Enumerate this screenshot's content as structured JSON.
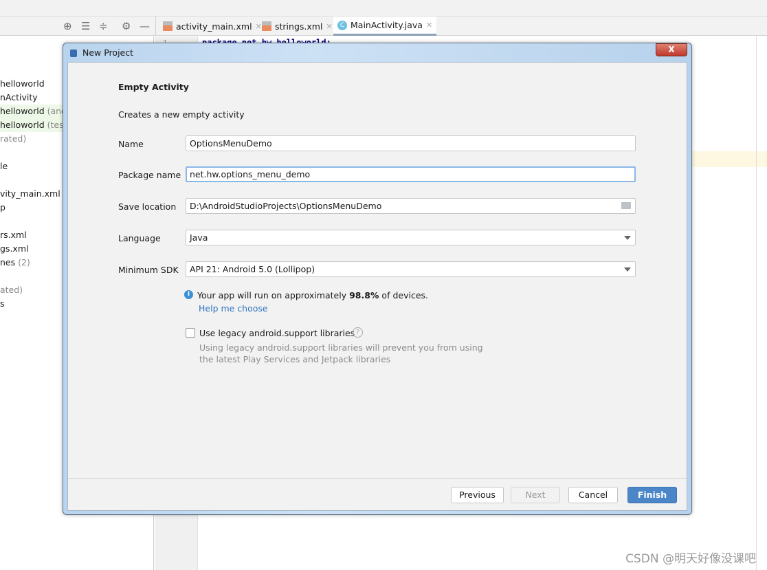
{
  "toolbar": {
    "icons": [
      "locate-icon",
      "expand-all-icon",
      "collapse-all-icon",
      "gear-icon",
      "minimize-icon"
    ]
  },
  "tabs": [
    {
      "label": "activity_main.xml",
      "icon": "xml-file-icon"
    },
    {
      "label": "strings.xml",
      "icon": "xml-file-icon"
    },
    {
      "label": "MainActivity.java",
      "icon": "java-class-icon",
      "active": true
    }
  ],
  "project_tree": [
    {
      "text": "helloworld",
      "dim": ""
    },
    {
      "text": "nActivity",
      "dim": ""
    },
    {
      "text": "helloworld",
      "dim": " (andr"
    },
    {
      "text": "helloworld",
      "dim": " (test)"
    },
    {
      "text": "",
      "dim": "rated)"
    },
    {
      "text": "le",
      "dim": ""
    },
    {
      "text": "vity_main.xml",
      "dim": ""
    },
    {
      "text": "p",
      "dim": ""
    },
    {
      "text": "rs.xml",
      "dim": ""
    },
    {
      "text": "gs.xml",
      "dim": ""
    },
    {
      "text": "nes",
      "dim": " (2)"
    },
    {
      "text": "",
      "dim": "ated)"
    },
    {
      "text": "s",
      "dim": ""
    }
  ],
  "editor": {
    "line_number": "1",
    "code": "package net.hw.helloworld;"
  },
  "dialog": {
    "title": "New Project",
    "close_label": "X",
    "heading": "Empty Activity",
    "subtitle": "Creates a new empty activity",
    "fields": {
      "name": {
        "label": "Name",
        "value": "OptionsMenuDemo"
      },
      "package": {
        "label": "Package name",
        "value": "net.hw.options_menu_demo"
      },
      "location": {
        "label": "Save location",
        "value": "D:\\AndroidStudioProjects\\OptionsMenuDemo"
      },
      "language": {
        "label": "Language",
        "value": "Java"
      },
      "min_sdk": {
        "label": "Minimum SDK",
        "value": "API 21: Android 5.0 (Lollipop)"
      }
    },
    "info": {
      "prefix": "Your app will run on approximately ",
      "percent": "98.8%",
      "suffix": " of devices.",
      "help_link": "Help me choose"
    },
    "legacy": {
      "label": "Use legacy android.support libraries",
      "checked": false,
      "hint1": "Using legacy android.support libraries will prevent you from using",
      "hint2": "the latest Play Services and Jetpack libraries"
    },
    "buttons": {
      "previous": "Previous",
      "next": "Next",
      "cancel": "Cancel",
      "finish": "Finish"
    }
  },
  "watermark": "CSDN @明天好像没课吧",
  "colors": {
    "accent": "#4a86c8",
    "link": "#2f74c0",
    "focus": "#8bb7e8"
  }
}
